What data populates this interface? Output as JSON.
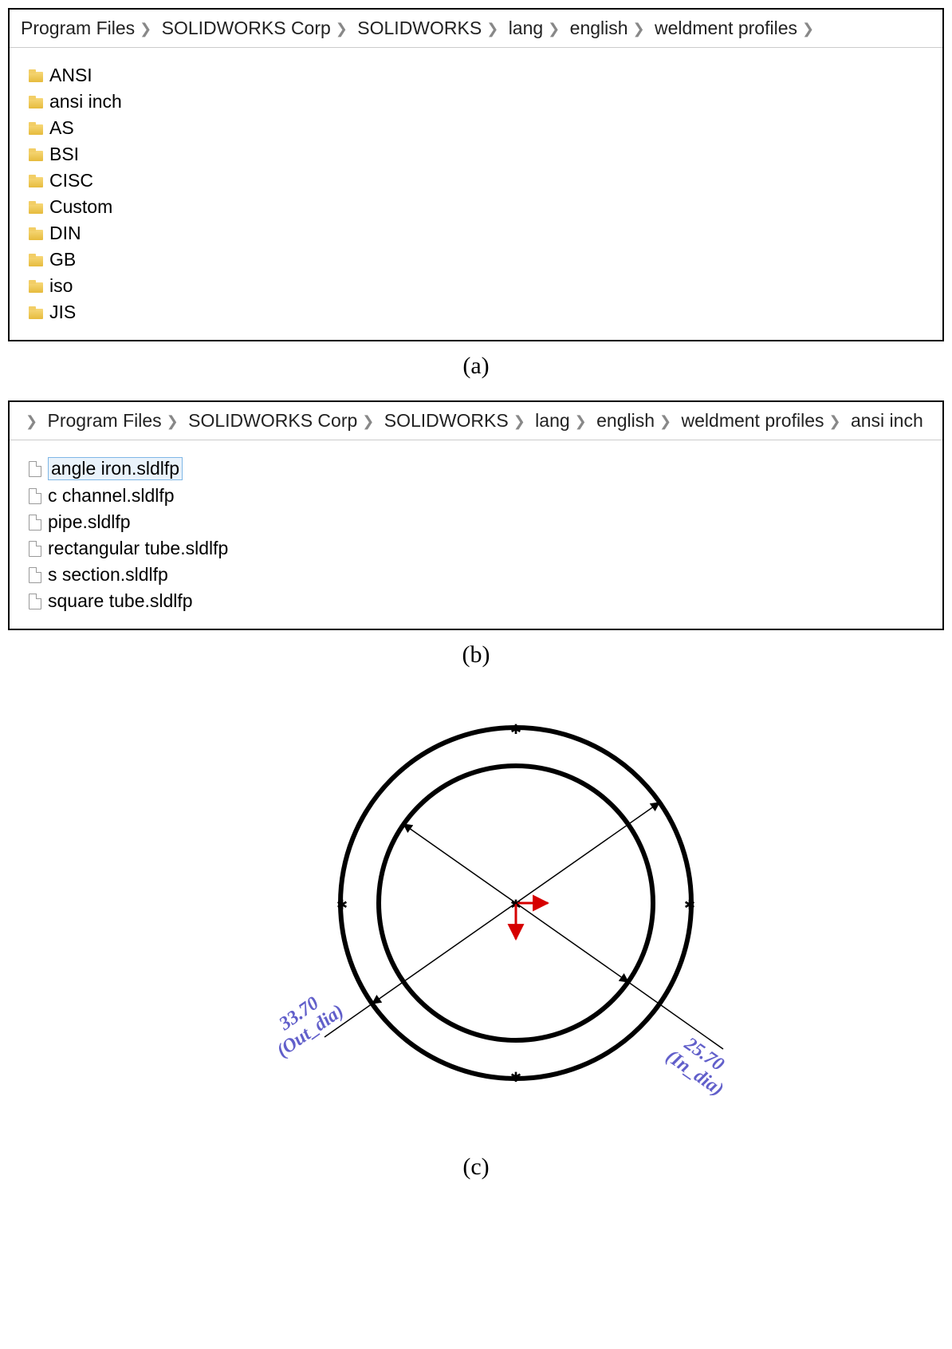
{
  "panel_a": {
    "breadcrumb": [
      "Program Files",
      "SOLIDWORKS Corp",
      "SOLIDWORKS",
      "lang",
      "english",
      "weldment profiles"
    ],
    "trailing_sep": true,
    "folders": [
      "ANSI",
      "ansi inch",
      "AS",
      "BSI",
      "CISC",
      "Custom",
      "DIN",
      "GB",
      "iso",
      "JIS"
    ]
  },
  "panel_b": {
    "breadcrumb": [
      "Program Files",
      "SOLIDWORKS Corp",
      "SOLIDWORKS",
      "lang",
      "english",
      "weldment profiles",
      "ansi inch"
    ],
    "leading_sep": true,
    "files": [
      {
        "name": "angle iron.sldlfp",
        "selected": true
      },
      {
        "name": "c channel.sldlfp",
        "selected": false
      },
      {
        "name": "pipe.sldlfp",
        "selected": false
      },
      {
        "name": "rectangular tube.sldlfp",
        "selected": false
      },
      {
        "name": "s section.sldlfp",
        "selected": false
      },
      {
        "name": "square tube.sldlfp",
        "selected": false
      }
    ]
  },
  "sketch": {
    "outer_value": "33.70",
    "outer_label": "(Out_dia)",
    "inner_value": "25.70",
    "inner_label": "(In_dia)"
  },
  "captions": {
    "a": "(a)",
    "b": "(b)",
    "c": "(c)"
  }
}
